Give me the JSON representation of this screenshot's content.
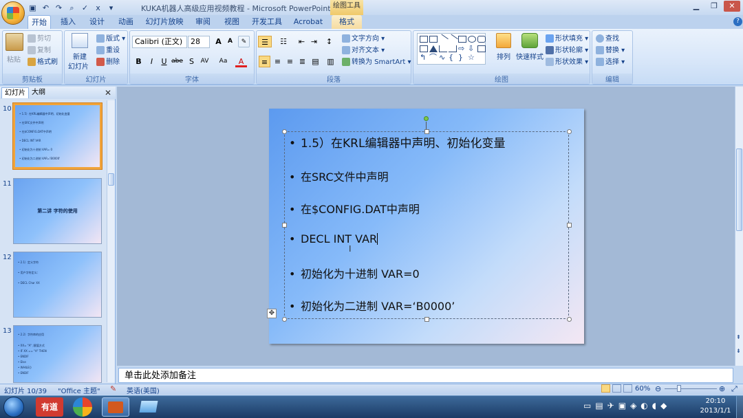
{
  "window": {
    "title": "KUKA机器人高级应用视频教程 - Microsoft PowerPoint",
    "context_tab_title": "绘图工具"
  },
  "tabs": [
    "开始",
    "插入",
    "设计",
    "动画",
    "幻灯片放映",
    "审阅",
    "视图",
    "开发工具",
    "Acrobat",
    "格式"
  ],
  "ribbon": {
    "clipboard": {
      "label": "剪贴板",
      "paste": "粘贴",
      "cut": "剪切",
      "copy": "复制",
      "format_painter": "格式刷"
    },
    "slides": {
      "label": "幻灯片",
      "new_slide": "新建",
      "new_slide2": "幻灯片",
      "layout": "版式",
      "reset": "重设",
      "delete": "删除"
    },
    "font": {
      "label": "字体",
      "font_name": "Calibri (正文)",
      "font_size": "28",
      "bold": "B",
      "italic": "I",
      "underline": "U",
      "strike": "abe",
      "shadow": "S"
    },
    "paragraph": {
      "label": "段落",
      "text_direction": "文字方向",
      "align_text": "对齐文本",
      "smartart": "转换为 SmartArt"
    },
    "drawing": {
      "label": "绘图",
      "arrange": "排列",
      "quick_styles": "快速样式",
      "shape_fill": "形状填充",
      "shape_outline": "形状轮廓",
      "shape_effects": "形状效果"
    },
    "editing": {
      "label": "编辑",
      "find": "查找",
      "replace": "替换",
      "select": "选择"
    }
  },
  "left_pane": {
    "tab_slides": "幻灯片",
    "tab_outline": "大纲",
    "thumbs": [
      {
        "num": "10",
        "lines": [
          "• 1.5）在KRL编辑器中声明、初始化变量",
          "• 在SRC文件中声明",
          "• 在$CONFIG.DAT中声明",
          "• DECL INT VAR",
          "• 初始化为十进制 VAR= 0",
          "• 初始化为二进制 VAR='B0000'"
        ]
      },
      {
        "num": "11",
        "title": "第二讲  字符的使用"
      },
      {
        "num": "12",
        "lines": [
          "• 2.1）定义字符",
          "• 用户字符定义：",
          "• DECL Char  XX"
        ]
      },
      {
        "num": "13",
        "lines": [
          "• 2.2）字符串的应用",
          "• XX= \"A\"  ;赋值方式",
          "• IF XX == \"A\" THEN",
          "• ENDIF",
          "• Else",
          "• WHILE()",
          "• ENDIF"
        ]
      }
    ]
  },
  "slide": {
    "bullets": [
      "1.5）在KRL编辑器中声明、初始化变量",
      "在SRC文件中声明",
      "在$CONFIG.DAT中声明",
      "DECL  INT  VAR",
      "初始化为十进制 VAR=0",
      "初始化为二进制 VAR=‘B0000’"
    ],
    "bullet_char": "•"
  },
  "notes": {
    "placeholder": "单击此处添加备注"
  },
  "status": {
    "slide_counter": "幻灯片 10/39",
    "theme": "\"Office 主题\"",
    "language": "英语(美国)",
    "zoom": "60%"
  },
  "taskbar": {
    "time": "20:10",
    "date": "2013/1/1",
    "app_youdao": "有道"
  }
}
